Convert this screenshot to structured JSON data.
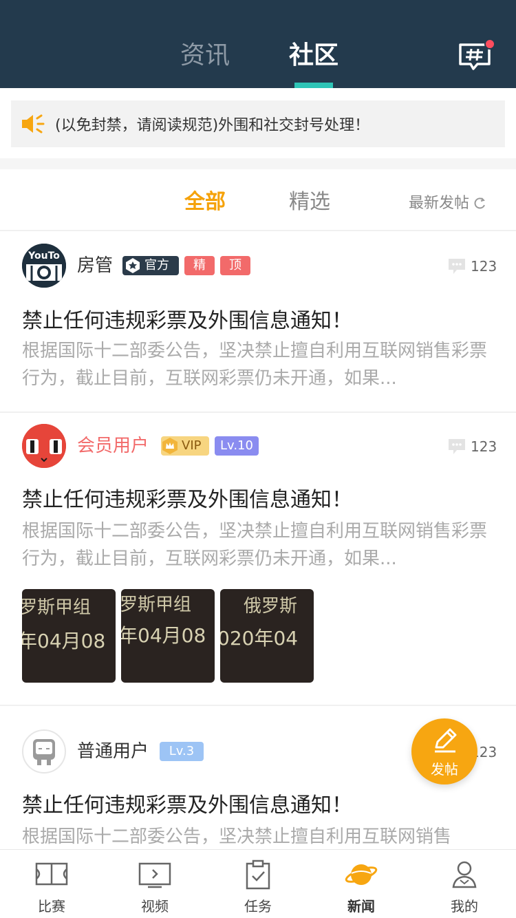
{
  "header": {
    "tabs": [
      {
        "label": "资讯",
        "active": false
      },
      {
        "label": "社区",
        "active": true
      }
    ],
    "accent_color": "#2ec4b6",
    "notification_dot": true
  },
  "notice": {
    "text": "(以免封禁，请阅读规范)外围和社交封号处理！",
    "icon": "speaker-icon"
  },
  "filter": {
    "all": "全部",
    "picked": "精选",
    "latest": "最新发帖"
  },
  "posts": [
    {
      "username": "房管",
      "avatar_text": "YouTo",
      "badges": {
        "official": "官方",
        "essence": "精",
        "top": "顶"
      },
      "comments": "123",
      "title": "禁止任何违规彩票及外围信息通知！",
      "body": "根据国际十二部委公告，坚决禁止擅自利用互联网销售彩票行为，截止目前，互联网彩票仍未开通，如果..."
    },
    {
      "username": "会员用户",
      "badges": {
        "vip": "VIP",
        "level": "Lv.10"
      },
      "comments": "123",
      "title": "禁止任何违规彩票及外围信息通知！",
      "body": "根据国际十二部委公告，坚决禁止擅自利用互联网销售彩票行为，截止目前，互联网彩票仍未开通，如果...",
      "thumbnails": [
        {
          "line1": "罗斯甲组",
          "line2": "年04月08"
        },
        {
          "line1": "罗斯甲组",
          "line2": "年04月08"
        },
        {
          "line1": "俄罗斯",
          "line2": "020年04"
        }
      ]
    },
    {
      "username": "普通用户",
      "badges": {
        "level": "Lv.3"
      },
      "comments": "123",
      "title": "禁止任何违规彩票及外围信息通知！",
      "body": "根据国际十二部委公告，坚决禁止擅自利用互联网销售"
    }
  ],
  "fab": {
    "label": "发帖"
  },
  "bottom_nav": [
    {
      "label": "比赛",
      "icon": "field-icon",
      "active": false
    },
    {
      "label": "视频",
      "icon": "video-icon",
      "active": false
    },
    {
      "label": "任务",
      "icon": "clipboard-icon",
      "active": false
    },
    {
      "label": "新闻",
      "icon": "planet-icon",
      "active": true
    },
    {
      "label": "我的",
      "icon": "profile-icon",
      "active": false
    }
  ],
  "colors": {
    "header_bg": "#233a4d",
    "orange": "#f5a20a",
    "vip_name": "#f26a6a",
    "badge_red": "#f26a6a",
    "level_purple": "#8a8cf0",
    "level_blue": "#9dc4f5"
  }
}
